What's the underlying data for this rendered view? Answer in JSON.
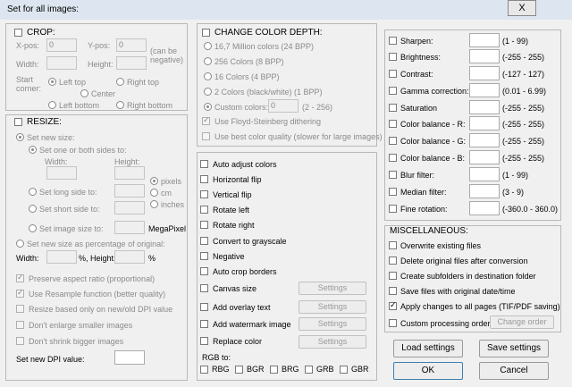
{
  "window": {
    "title": "Set for all images:",
    "close_label": "X"
  },
  "crop": {
    "title": "CROP:",
    "x_pos_label": "X-pos:",
    "x_pos_value": "0",
    "y_pos_label": "Y-pos:",
    "y_pos_value": "0",
    "can_be_negative": "(can be negative)",
    "width_label": "Width:",
    "height_label": "Height:",
    "start_corner_label": "Start corner:",
    "left_top": "Left top",
    "right_top": "Right top",
    "center": "Center",
    "left_bottom": "Left bottom",
    "right_bottom": "Right bottom"
  },
  "resize": {
    "title": "RESIZE:",
    "set_new_size": "Set new size:",
    "set_one_or_both": "Set one or both sides to:",
    "width_label": "Width:",
    "height_label": "Height:",
    "pixels": "pixels",
    "cm": "cm",
    "inches": "inches",
    "set_long_side": "Set long side to:",
    "set_short_side": "Set short side to:",
    "set_image_size": "Set image size to:",
    "megapixel": "MegaPixel",
    "set_percentage": "Set new size as percentage of original:",
    "pct_width_label": "Width:",
    "pct_height_label": "%, Height:",
    "pct_suffix": "%",
    "preserve_aspect": "Preserve aspect ratio (proportional)",
    "use_resample": "Use Resample function (better quality)",
    "resize_based_on_dpi": "Resize based only on new/old DPI value",
    "dont_enlarge": "Don't enlarge smaller images",
    "dont_shrink": "Don't shrink bigger images",
    "set_new_dpi": "Set new DPI value:"
  },
  "color_depth": {
    "title": "CHANGE COLOR DEPTH:",
    "opt_24": "16,7 Million colors (24 BPP)",
    "opt_8": "256 Colors (8 BPP)",
    "opt_4": "16 Colors (4 BPP)",
    "opt_1": "2 Colors (black/white) (1 BPP)",
    "custom_label": "Custom colors:",
    "custom_value": "0",
    "custom_range": "(2 - 256)",
    "floyd": "Use Floyd-Steinberg dithering",
    "best_quality": "Use best color quality (slower for large images)"
  },
  "transforms": {
    "auto_adjust": "Auto adjust colors",
    "h_flip": "Horizontal flip",
    "v_flip": "Vertical flip",
    "rot_left": "Rotate left",
    "rot_right": "Rotate right",
    "grayscale": "Convert to grayscale",
    "negative": "Negative",
    "auto_crop": "Auto crop borders",
    "canvas_size": "Canvas size",
    "overlay_text": "Add overlay text",
    "watermark": "Add watermark image",
    "replace_color": "Replace color",
    "settings": "Settings",
    "rgb_to": "RGB to:",
    "rgb_opts": [
      "RBG",
      "BGR",
      "BRG",
      "GRB",
      "GBR"
    ]
  },
  "adjust": {
    "sharpen": "Sharpen:",
    "sharpen_range": "(1 - 99)",
    "brightness": "Brightness:",
    "brightness_range": "(-255 - 255)",
    "contrast": "Contrast:",
    "contrast_range": "(-127 - 127)",
    "gamma": "Gamma correction:",
    "gamma_range": "(0.01 - 6.99)",
    "saturation": "Saturation",
    "saturation_range": "(-255 - 255)",
    "cb_r": "Color balance - R:",
    "cb_r_range": "(-255 - 255)",
    "cb_g": "Color balance - G:",
    "cb_g_range": "(-255 - 255)",
    "cb_b": "Color balance - B:",
    "cb_b_range": "(-255 - 255)",
    "blur": "Blur filter:",
    "blur_range": "(1 - 99)",
    "median": "Median filter:",
    "median_range": "(3 - 9)",
    "fine_rot": "Fine rotation:",
    "fine_rot_range": "(-360.0 - 360.0)"
  },
  "misc": {
    "title": "MISCELLANEOUS:",
    "overwrite": "Overwrite existing files",
    "delete_originals": "Delete original files after conversion",
    "subfolders": "Create subfolders in destination folder",
    "save_date": "Save files with original date/time",
    "apply_all_pages": "Apply changes to all pages (TIF/PDF saving)",
    "custom_order": "Custom processing order",
    "change_order": "Change order"
  },
  "buttons": {
    "load": "Load settings",
    "save": "Save settings",
    "ok": "OK",
    "cancel": "Cancel"
  }
}
